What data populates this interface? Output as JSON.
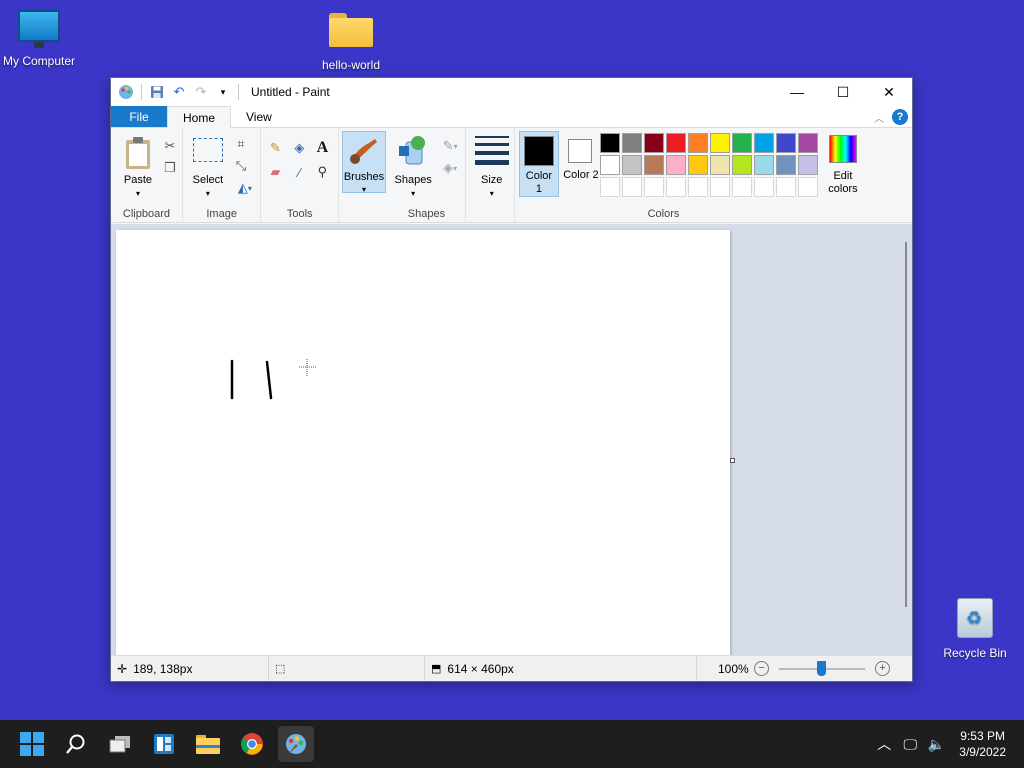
{
  "desktop": {
    "icons": [
      {
        "label": "My Computer"
      },
      {
        "label": "hello-world"
      },
      {
        "label": "Recycle Bin"
      }
    ]
  },
  "window": {
    "title": "Untitled - Paint",
    "tabs": [
      {
        "label": "File"
      },
      {
        "label": "Home"
      },
      {
        "label": "View"
      }
    ],
    "groups": {
      "clipboard": {
        "name": "Clipboard",
        "paste": "Paste"
      },
      "image": {
        "name": "Image",
        "select": "Select"
      },
      "tools": {
        "name": "Tools"
      },
      "brushes": {
        "label": "Brushes"
      },
      "shapes": {
        "name": "Shapes",
        "label": "Shapes"
      },
      "size": {
        "label": "Size"
      },
      "colors": {
        "name": "Colors",
        "color1": "Color 1",
        "color2": "Color 2",
        "edit": "Edit colors",
        "color1_value": "#000000",
        "color2_value": "#ffffff",
        "palette_row1": [
          "#000000",
          "#7f7f7f",
          "#880015",
          "#ed1c24",
          "#ff7f27",
          "#fff200",
          "#22b14c",
          "#00a2e8",
          "#3f48cc",
          "#a349a4"
        ],
        "palette_row2": [
          "#ffffff",
          "#c3c3c3",
          "#b97a57",
          "#ffaec9",
          "#ffc90e",
          "#efe4b0",
          "#b5e61d",
          "#99d9ea",
          "#7092be",
          "#c8bfe7"
        ]
      }
    },
    "status": {
      "cursor_pos": "189, 138px",
      "canvas_size": "614 × 460px",
      "zoom": "100%",
      "zoom_level_percent": 100
    }
  },
  "taskbar": {
    "time": "9:53 PM",
    "date": "3/9/2022"
  }
}
